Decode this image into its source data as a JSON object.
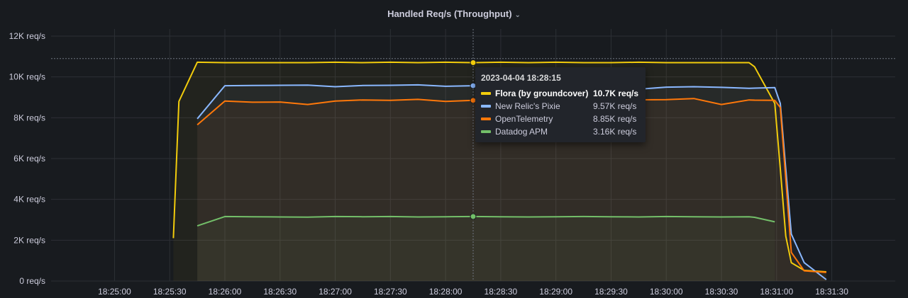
{
  "panel": {
    "title": "Handled Req/s (Throughput)"
  },
  "chart_data": {
    "type": "line",
    "title": "Handled Req/s (Throughput)",
    "xlabel": "",
    "ylabel": "",
    "x": [
      "18:25:32",
      "18:25:35",
      "18:25:45",
      "18:26:00",
      "18:26:15",
      "18:26:30",
      "18:26:45",
      "18:27:00",
      "18:27:15",
      "18:27:30",
      "18:27:45",
      "18:28:00",
      "18:28:15",
      "18:28:30",
      "18:28:45",
      "18:29:00",
      "18:29:15",
      "18:29:30",
      "18:29:45",
      "18:30:00",
      "18:30:15",
      "18:30:30",
      "18:30:45",
      "18:30:48",
      "18:30:59",
      "18:31:02",
      "18:31:05",
      "18:31:08",
      "18:31:15",
      "18:31:27"
    ],
    "x_ticks": [
      "18:25:00",
      "18:25:30",
      "18:26:00",
      "18:26:30",
      "18:27:00",
      "18:27:30",
      "18:28:00",
      "18:28:30",
      "18:29:00",
      "18:29:30",
      "18:30:00",
      "18:30:30",
      "18:31:00",
      "18:31:30"
    ],
    "y_ticks": [
      "0 req/s",
      "2K req/s",
      "4K req/s",
      "6K req/s",
      "8K req/s",
      "10K req/s",
      "12K req/s"
    ],
    "ylim": [
      0,
      12000
    ],
    "grid": true,
    "series": [
      {
        "name": "Flora (by groundcover)",
        "color": "#f2cc0c",
        "values": [
          2100,
          8800,
          10720,
          10700,
          10700,
          10700,
          10700,
          10720,
          10700,
          10720,
          10700,
          10720,
          10700,
          10720,
          10700,
          10720,
          10700,
          10700,
          10720,
          10700,
          10700,
          10700,
          10700,
          10500,
          8700,
          5500,
          2200,
          900,
          520,
          450
        ]
      },
      {
        "name": "New Relic's Pixie",
        "color": "#8ab8ff",
        "values": [
          null,
          null,
          7950,
          9570,
          9580,
          9590,
          9600,
          9520,
          9580,
          9590,
          9610,
          9540,
          9570,
          9560,
          9420,
          9300,
          9280,
          9310,
          9400,
          9500,
          9520,
          9490,
          9440,
          9450,
          9480,
          8700,
          5500,
          2300,
          900,
          70
        ]
      },
      {
        "name": "OpenTelemetry",
        "color": "#ff780a",
        "values": [
          null,
          null,
          7650,
          8820,
          8760,
          8770,
          8650,
          8820,
          8870,
          8850,
          8900,
          8800,
          8850,
          8800,
          8880,
          8850,
          8860,
          8870,
          8880,
          8890,
          8940,
          8650,
          8870,
          8860,
          8850,
          8500,
          5000,
          1400,
          500,
          420
        ]
      },
      {
        "name": "Datadog APM",
        "color": "#73bf69",
        "values": [
          null,
          null,
          2700,
          3160,
          3150,
          3140,
          3130,
          3160,
          3150,
          3160,
          3140,
          3150,
          3160,
          3150,
          3140,
          3150,
          3160,
          3150,
          3140,
          3160,
          3150,
          3140,
          3150,
          3120,
          2900,
          null,
          null,
          null,
          null,
          null
        ]
      }
    ]
  },
  "tooltip": {
    "time": "2023-04-04 18:28:15",
    "rows": [
      {
        "name": "Flora (by groundcover)",
        "value": "10.7K req/s",
        "color": "#f2cc0c",
        "bold": true
      },
      {
        "name": "New Relic's Pixie",
        "value": "9.57K req/s",
        "color": "#8ab8ff",
        "bold": false
      },
      {
        "name": "OpenTelemetry",
        "value": "8.85K req/s",
        "color": "#ff780a",
        "bold": false
      },
      {
        "name": "Datadog APM",
        "value": "3.16K req/s",
        "color": "#73bf69",
        "bold": false
      }
    ]
  },
  "crosshair": {
    "x": "18:28:15",
    "y": 10900
  }
}
